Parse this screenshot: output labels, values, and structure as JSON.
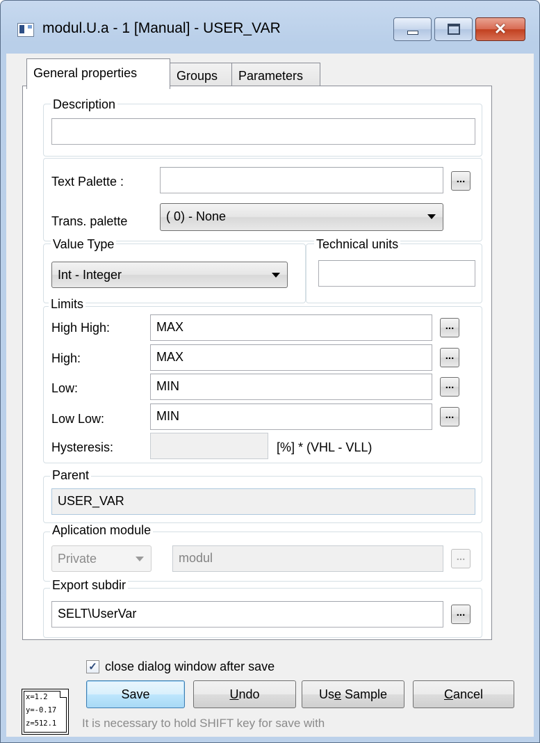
{
  "window": {
    "title": "modul.U.a - 1 [Manual] - USER_VAR",
    "close_glyph": "✕"
  },
  "tabs": [
    {
      "label": "General properties",
      "active": true
    },
    {
      "label": "Groups",
      "active": false
    },
    {
      "label": "Parameters",
      "active": false
    }
  ],
  "description": {
    "legend": "Description",
    "value": ""
  },
  "palette": {
    "text_palette_label": "Text Palette :",
    "text_palette_value": "",
    "browse": "...",
    "trans_palette_label": "Trans. palette",
    "trans_palette_value": "( 0) - None"
  },
  "value_type": {
    "legend": "Value Type",
    "value": "Int - Integer"
  },
  "technical_units": {
    "legend": "Technical units",
    "value": ""
  },
  "limits": {
    "legend": "Limits",
    "rows": [
      {
        "label": "High High:",
        "value": "MAX"
      },
      {
        "label": "High:",
        "value": "MAX"
      },
      {
        "label": "Low:",
        "value": "MIN"
      },
      {
        "label": "Low Low:",
        "value": "MIN"
      }
    ],
    "hysteresis_label": "Hysteresis:",
    "hysteresis_value": "",
    "hysteresis_unit": "[%] * (VHL - VLL)"
  },
  "parent": {
    "legend": "Parent",
    "value": "USER_VAR"
  },
  "application_module": {
    "legend": "Aplication module",
    "scope": "Private",
    "module": "modul"
  },
  "export_subdir": {
    "legend": "Export subdir",
    "value": "SELT\\UserVar"
  },
  "footer": {
    "coords": [
      "x=1.2",
      "y=-0.17",
      "z=512.1"
    ],
    "checkbox_label": "close dialog window after save",
    "checkbox_checked": true,
    "checkmark": "✓",
    "save": "Save",
    "undo_u": "U",
    "undo_rest": "ndo",
    "use_sample_pre": "Us",
    "use_sample_u": "e",
    "use_sample_rest": " Sample",
    "cancel_u": "C",
    "cancel_rest": "ancel",
    "hint": "It is necessary to hold SHIFT key for save with"
  },
  "colors": {
    "titlebar": "#c7d9ef",
    "client": "#f0f0f0",
    "close_button": "#c1401f",
    "default_button_border": "#3c7fb1"
  }
}
